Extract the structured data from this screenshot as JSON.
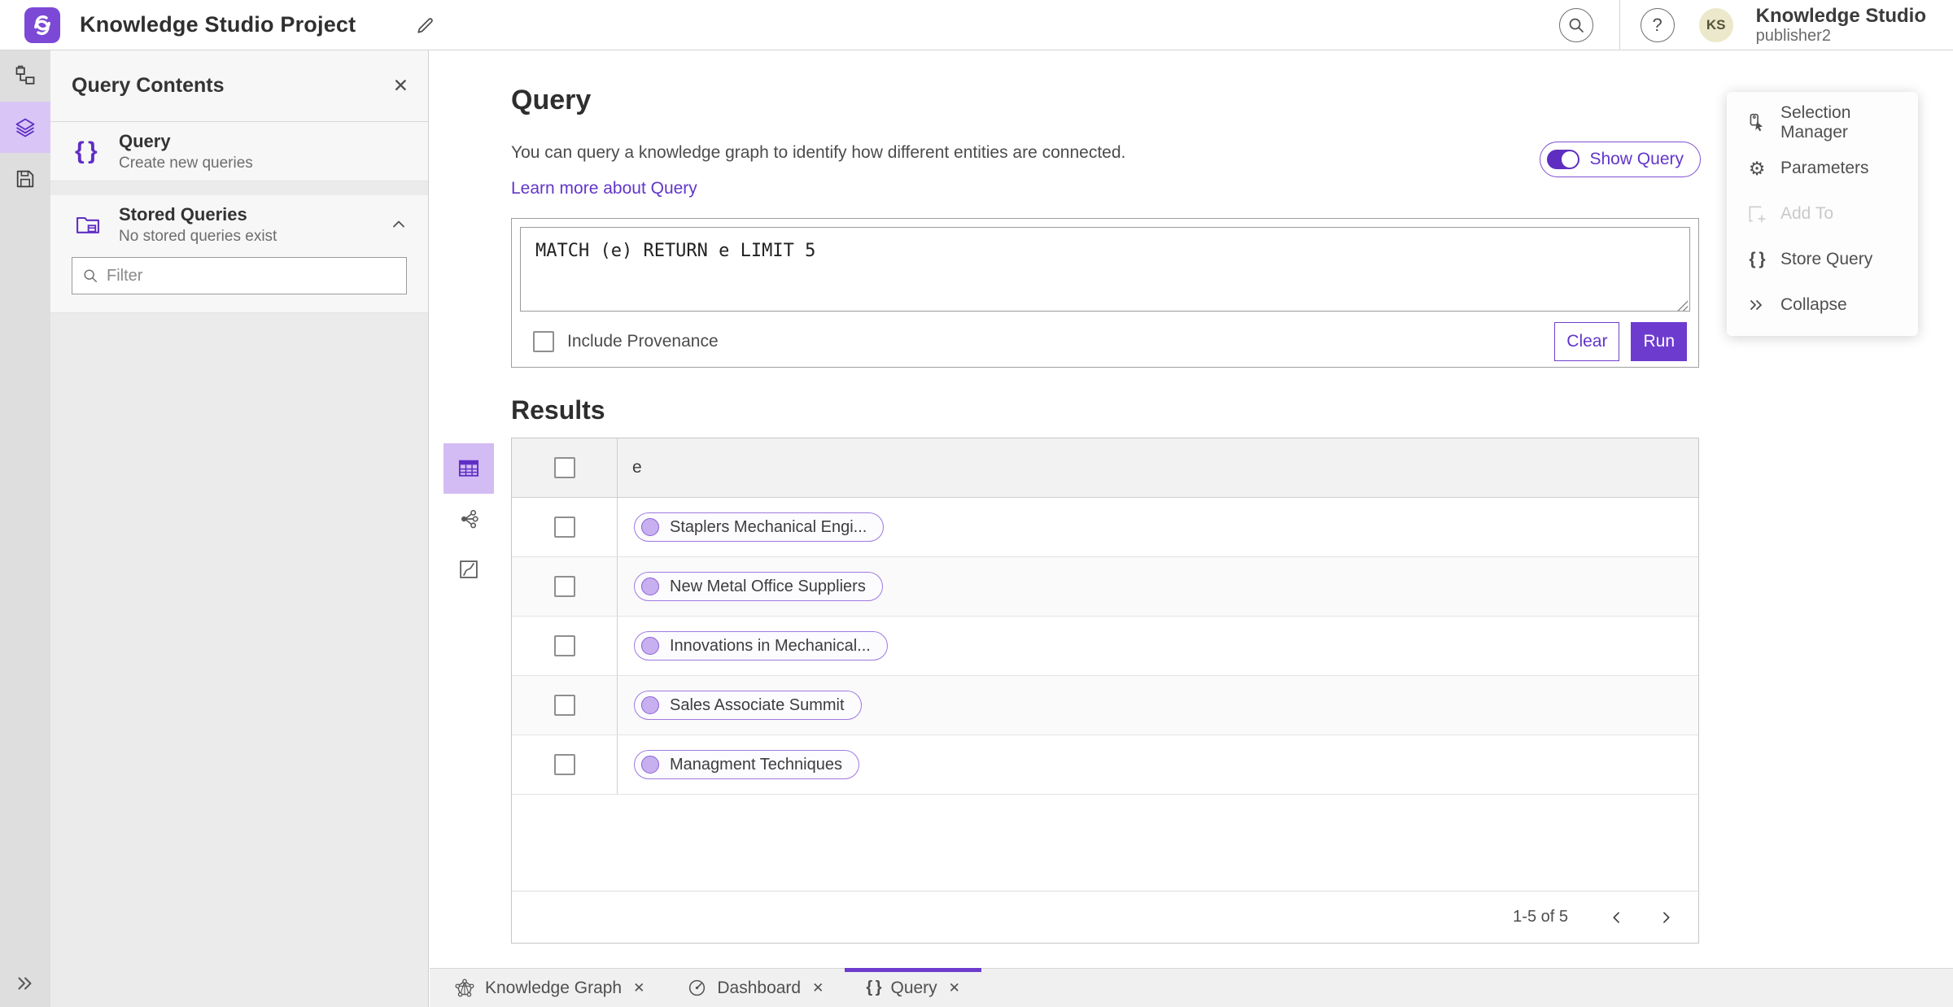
{
  "colors": {
    "accent": "#6d3cce",
    "accent_dark": "#5f2ec0",
    "accent_light_bg": "#d9c6f6",
    "link": "#6236c9",
    "pill_border": "#9f7ae0",
    "pill_dot_fill": "#c7aff0",
    "avatar_bg": "#ebe8cb"
  },
  "glyphs": {
    "close": "✕",
    "help": "?",
    "braces": "{ }",
    "gear": "⚙"
  },
  "icons": {
    "header": [
      "app-logo",
      "pencil-icon",
      "search-icon",
      "help-icon",
      "avatar"
    ],
    "rail": [
      "schema-icon",
      "layers-icon",
      "save-icon",
      "expand-double-chevron-icon"
    ],
    "sidebar": [
      "braces-icon",
      "folder-icon",
      "chevron-up-icon",
      "search-icon",
      "close-icon"
    ],
    "views": [
      "table-view-icon",
      "link-chart-view-icon",
      "map-view-icon"
    ],
    "menu": [
      "selection-manager-icon",
      "gear-icon",
      "add-to-icon",
      "braces-icon",
      "collapse-icon"
    ],
    "tabs": [
      "knowledge-graph-icon",
      "dashboard-icon",
      "braces-icon"
    ]
  },
  "header": {
    "title": "Knowledge Studio Project",
    "user_name": "Knowledge Studio",
    "user_role": "publisher2",
    "avatar_initials": "KS"
  },
  "sidebar": {
    "title": "Query Contents",
    "items": [
      {
        "label": "Query",
        "sublabel": "Create new queries"
      },
      {
        "label": "Stored Queries",
        "sublabel": "No stored queries exist"
      }
    ],
    "filter_placeholder": "Filter"
  },
  "query_panel": {
    "title": "Query",
    "description": "You can query a knowledge graph to identify how different entities are connected.",
    "learn_more": "Learn more about Query",
    "show_query_label": "Show Query",
    "show_query_on": true,
    "query_text": "MATCH (e) RETURN e LIMIT 5",
    "include_provenance_label": "Include Provenance",
    "include_provenance_checked": false,
    "clear_label": "Clear",
    "run_label": "Run"
  },
  "results": {
    "title": "Results",
    "column_header": "e",
    "rows": [
      "Staplers Mechanical Engi...",
      "New Metal Office Suppliers",
      "Innovations in Mechanical...",
      "Sales Associate Summit",
      "Managment Techniques"
    ],
    "pagination_label": "1-5 of 5"
  },
  "actions_menu": {
    "items": [
      {
        "label": "Selection Manager",
        "disabled": false
      },
      {
        "label": "Parameters",
        "disabled": false
      },
      {
        "label": "Add To",
        "disabled": true
      },
      {
        "label": "Store Query",
        "disabled": false
      },
      {
        "label": "Collapse",
        "disabled": false
      }
    ]
  },
  "tabs": [
    {
      "label": "Knowledge Graph",
      "active": false
    },
    {
      "label": "Dashboard",
      "active": false
    },
    {
      "label": "Query",
      "active": true
    }
  ]
}
